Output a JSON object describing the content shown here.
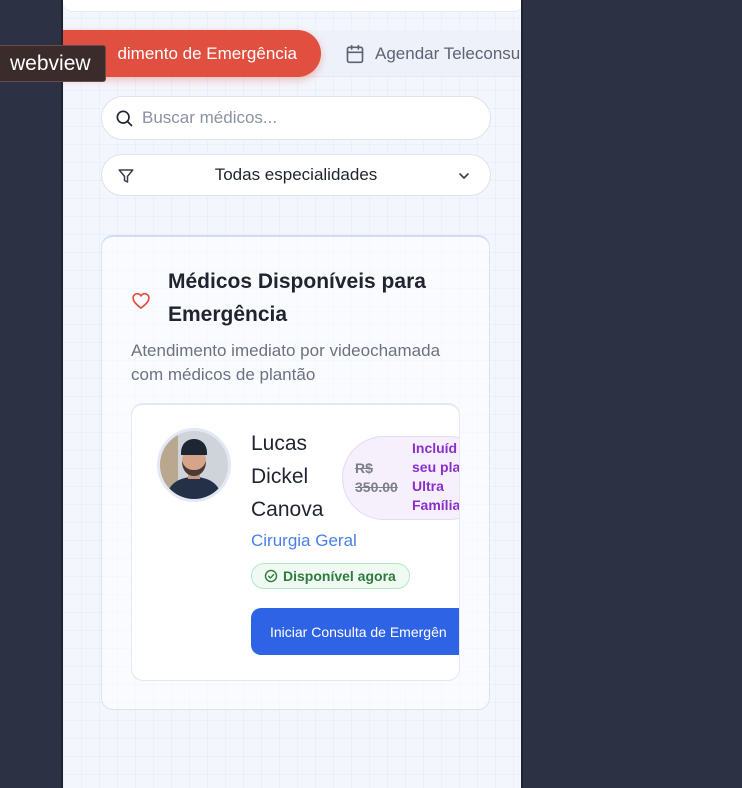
{
  "debug_label": "webview",
  "tabs": {
    "emergency_label": "dimento de Emergência",
    "teleconsult_label": "Agendar Teleconsu"
  },
  "search": {
    "placeholder": "Buscar médicos..."
  },
  "filter": {
    "selected": "Todas especialidades"
  },
  "emergency_section": {
    "title": "Médicos Disponíveis para Emergência",
    "description": "Atendimento imediato por videochamada com médicos de plantão"
  },
  "doctor": {
    "name": "Lucas Dickel Canova",
    "specialty": "Cirurgia Geral",
    "price_old": "R$ 350.00",
    "price_included": "Incluíd seu pla Ultra Família",
    "availability": "Disponível agora",
    "cta": "Iniciar Consulta de Emergên"
  },
  "colors": {
    "accent_red": "#e04f3f",
    "primary_blue": "#2f63e6",
    "available_green": "#2f7a3e",
    "plan_purple": "#8a2fc9"
  }
}
